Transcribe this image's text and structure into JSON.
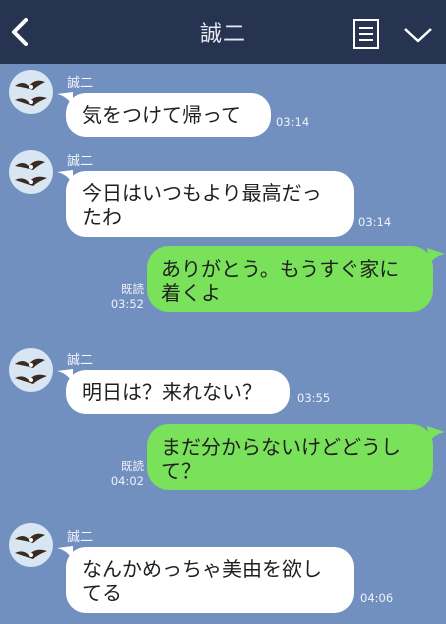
{
  "header": {
    "title": "誠二",
    "back_icon": "chevron-left-icon",
    "menu_icon": "list-icon",
    "collapse_icon": "chevron-down-icon",
    "bg_color": "#263351"
  },
  "chat_bg_color": "#7190c0",
  "incoming_color": "#ffffff",
  "outgoing_color": "#7ae25a",
  "messages": [
    {
      "direction": "in",
      "sender": "誠二",
      "text": "気をつけて帰って",
      "time": "03:14"
    },
    {
      "direction": "in",
      "sender": "誠二",
      "text": "今日はいつもより最高だっ\nたわ",
      "time": "03:14"
    },
    {
      "direction": "out",
      "text": "ありがとう。もうすぐ家に\n着くよ",
      "read": "既読",
      "time": "03:52"
    },
    {
      "direction": "in",
      "sender": "誠二",
      "text": "明日は？来れない？",
      "time": "03:55"
    },
    {
      "direction": "out",
      "text": "まだ分からないけどどうし\nて？",
      "read": "既読",
      "time": "04:02"
    },
    {
      "direction": "in",
      "sender": "誠二",
      "text": "なんかめっちゃ美由を欲し\nてる",
      "time": "04:06"
    }
  ]
}
